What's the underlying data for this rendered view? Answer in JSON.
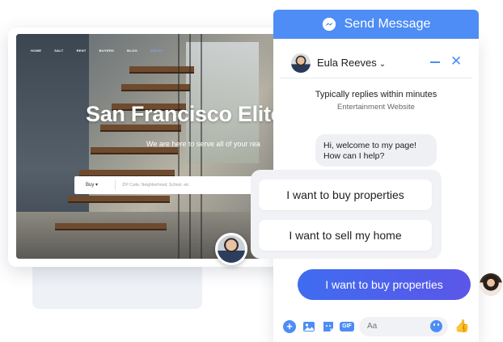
{
  "website": {
    "nav": [
      "HOME",
      "SALT",
      "RENT",
      "BUYERS",
      "BLOG",
      "ABOUT"
    ],
    "title": "San Francisco Elite",
    "subtitle": "We are here to serve all of your rea",
    "search": {
      "type_value": "Buy ▾",
      "placeholder": "ZIP Code, Neighborhood, School, etc"
    }
  },
  "messenger": {
    "send_button_label": "Send Message",
    "header": {
      "name": "Eula Reeves",
      "caret": "⌄",
      "close": "✕"
    },
    "status": {
      "reply_time": "Typically replies within minutes",
      "page_type": "Entertainment Website"
    },
    "incoming_message": "Hi, welcome to my page! How can I help?",
    "quick_replies": [
      "I want to buy properties",
      "I want to sell my home"
    ],
    "outgoing_message": "I want to buy properties",
    "composer": {
      "placeholder": "Aa",
      "plus": "+",
      "gif": "GIF",
      "like": "👍"
    }
  },
  "colors": {
    "brand_blue": "#4d8df5",
    "bubble_grey": "#eef0f3",
    "outgoing_gradient_start": "#3f6cf0",
    "outgoing_gradient_end": "#5b56e8"
  },
  "icons": [
    "messenger-icon",
    "plus-icon",
    "image-icon",
    "sticker-icon",
    "gif-icon",
    "emoji-icon",
    "like-icon",
    "minimize-icon",
    "close-icon"
  ]
}
